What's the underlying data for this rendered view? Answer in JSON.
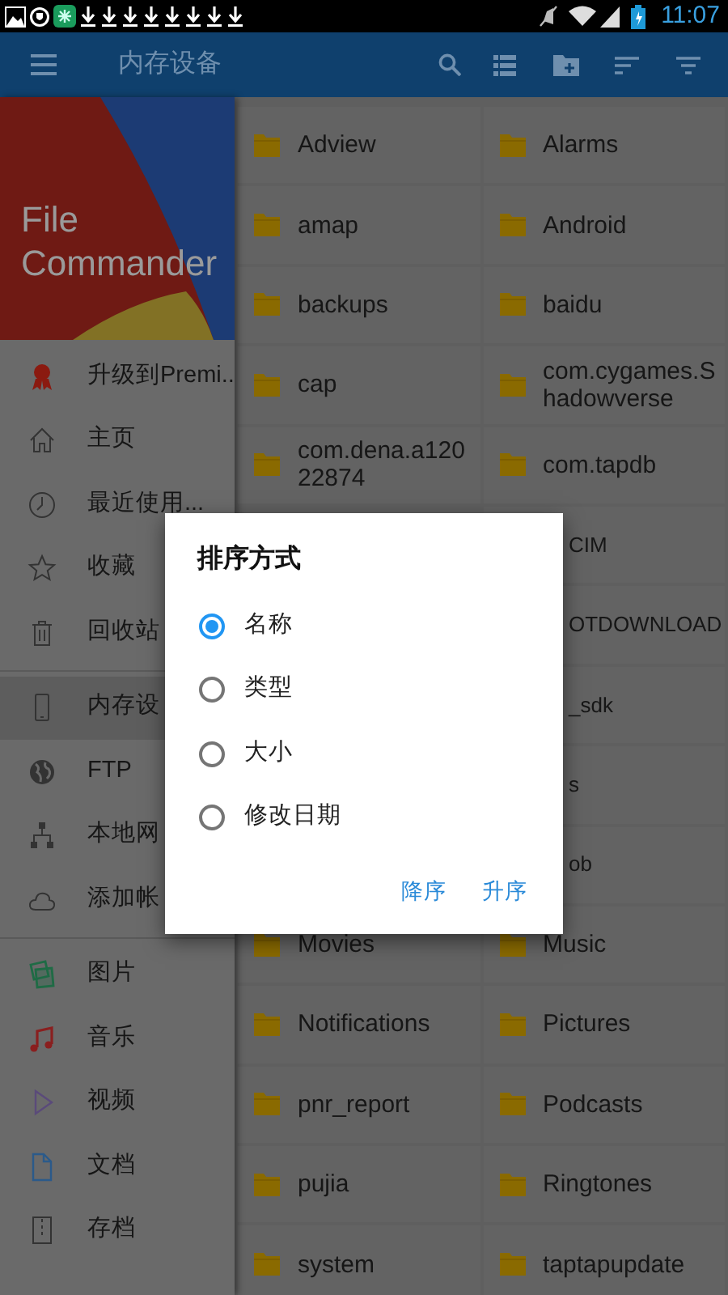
{
  "status_bar": {
    "time": "11:07"
  },
  "toolbar": {
    "title": "内存设备"
  },
  "drawer": {
    "app_name": "File Commander",
    "sections": [
      [
        {
          "label": "升级到Premi...",
          "selected": false
        },
        {
          "label": "主页",
          "selected": false
        },
        {
          "label": "最近使用...",
          "selected": false
        },
        {
          "label": "收藏",
          "selected": false
        },
        {
          "label": "回收站",
          "selected": false
        }
      ],
      [
        {
          "label": "内存设",
          "selected": true
        },
        {
          "label": "FTP",
          "selected": false
        },
        {
          "label": "本地网",
          "selected": false
        },
        {
          "label": "添加帐",
          "selected": false
        }
      ],
      [
        {
          "label": "图片",
          "selected": false
        },
        {
          "label": "音乐",
          "selected": false
        },
        {
          "label": "视频",
          "selected": false
        },
        {
          "label": "文档",
          "selected": false
        },
        {
          "label": "存档",
          "selected": false
        }
      ]
    ]
  },
  "files": [
    {
      "name": "Adview",
      "kind": "folder"
    },
    {
      "name": "Alarms",
      "kind": "folder"
    },
    {
      "name": "amap",
      "kind": "folder"
    },
    {
      "name": "Android",
      "kind": "folder"
    },
    {
      "name": "backups",
      "kind": "folder"
    },
    {
      "name": "baidu",
      "kind": "folder"
    },
    {
      "name": "cap",
      "kind": "folder"
    },
    {
      "name": "com.cygames.Shadowverse",
      "kind": "folder"
    },
    {
      "name": "com.dena.a12022874",
      "kind": "folder"
    },
    {
      "name": "com.tapdb",
      "kind": "folder"
    },
    {
      "name": "CIM",
      "kind": "clipped"
    },
    {
      "name": "OTDOWNLOAD",
      "kind": "clipped"
    },
    {
      "name": "_sdk",
      "kind": "clipped"
    },
    {
      "name": "s",
      "kind": "clipped"
    },
    {
      "name": "ob",
      "kind": "clipped"
    },
    {
      "name": "Movies",
      "kind": "folder"
    },
    {
      "name": "Music",
      "kind": "folder"
    },
    {
      "name": "Notifications",
      "kind": "folder"
    },
    {
      "name": "Pictures",
      "kind": "folder"
    },
    {
      "name": "pnr_report",
      "kind": "folder"
    },
    {
      "name": "Podcasts",
      "kind": "folder"
    },
    {
      "name": "pujia",
      "kind": "folder"
    },
    {
      "name": "Ringtones",
      "kind": "folder"
    },
    {
      "name": "system",
      "kind": "folder"
    },
    {
      "name": "taptapupdate",
      "kind": "folder"
    }
  ],
  "sort_dialog": {
    "title": "排序方式",
    "options": [
      {
        "label": "名称",
        "selected": true
      },
      {
        "label": "类型",
        "selected": false
      },
      {
        "label": "大小",
        "selected": false
      },
      {
        "label": "修改日期",
        "selected": false
      }
    ],
    "buttons": [
      "降序",
      "升序"
    ]
  }
}
